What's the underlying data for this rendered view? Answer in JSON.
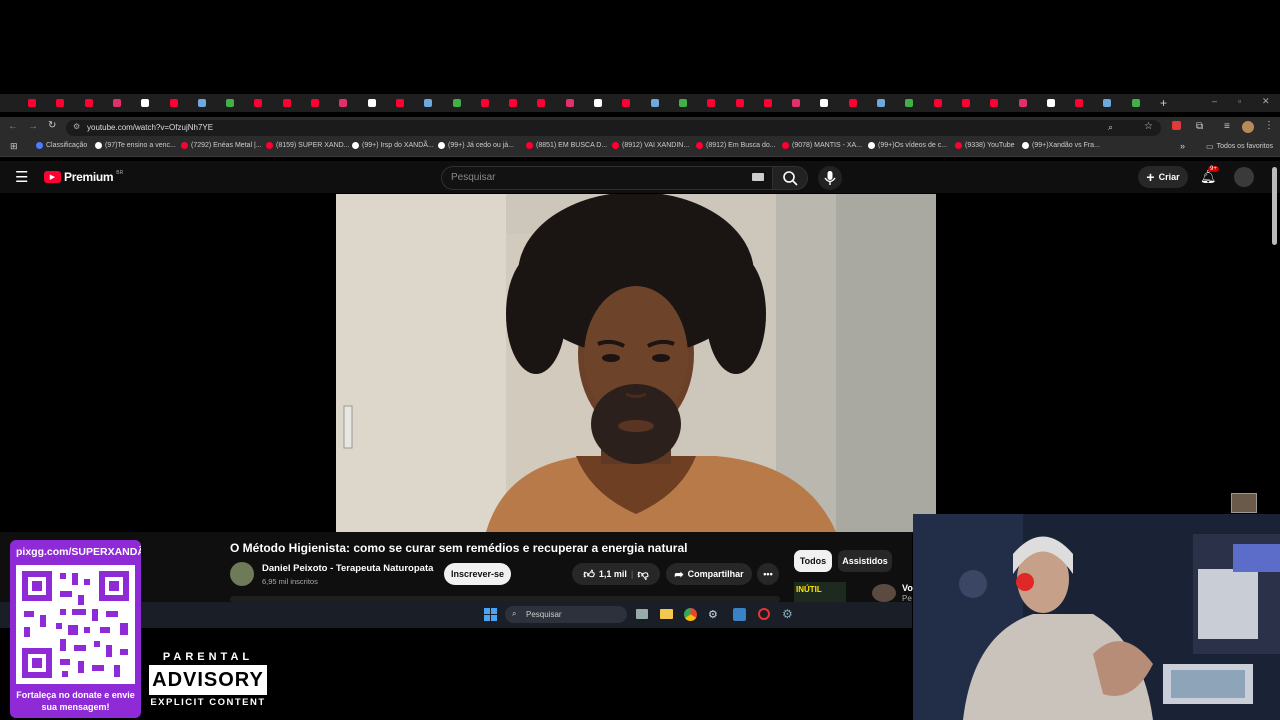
{
  "browser": {
    "tabs_count": 40,
    "url": "youtube.com/watch?v=OfzujNh7YE",
    "bookmarks": [
      {
        "label": "Classificação",
        "color": "#4d7cff"
      },
      {
        "label": "(97)Te ensino a venc...",
        "color": "#ffffff"
      },
      {
        "label": "(7292) Enéas Metal |...",
        "color": "#ff0033"
      },
      {
        "label": "(8159) SUPER XAND...",
        "color": "#ff0033"
      },
      {
        "label": "(99+) Irsp do XANDÃ...",
        "color": "#ffffff"
      },
      {
        "label": "(99+) Já cedo ou já...",
        "color": "#ffffff"
      },
      {
        "label": "(8851) EM BUSCA D...",
        "color": "#ff0033"
      },
      {
        "label": "(8912) VAI XANDIN...",
        "color": "#ff0033"
      },
      {
        "label": "(8912) Em Busca do...",
        "color": "#ff0033"
      },
      {
        "label": "(9078) MANTIS - XA...",
        "color": "#ff0033"
      },
      {
        "label": "(99+)Os vídeos de c...",
        "color": "#ffffff"
      },
      {
        "label": "(9338) YouTube",
        "color": "#ff0033"
      },
      {
        "label": "(99+)Xandão vs Fra...",
        "color": "#ffffff"
      }
    ],
    "all_bookmarks_label": "Todos os favoritos"
  },
  "youtube": {
    "logo_text": "Premium",
    "logo_badge": "BR",
    "search_placeholder": "Pesquisar",
    "create_label": "Criar",
    "notifications_count": "9+",
    "video_title": "O Método Higienista: como se curar sem remédios e recuperar a energia natural",
    "channel_name": "Daniel Peixoto - Terapeuta Naturopata",
    "subscribers": "6,95 mil inscritos",
    "subscribe_label": "Inscrever-se",
    "like_count": "1,1 mil",
    "share_label": "Compartilhar",
    "chip_all": "Todos",
    "chip_watched": "Assistidos",
    "related_thumb_text": "INÚTIL",
    "related_title_partial": "Vo",
    "related_subtitle_partial": "Pe"
  },
  "taskbar": {
    "search_placeholder": "Pesquisar"
  },
  "overlay": {
    "qr_url": "pixgg.com/SUPERXANDÃ",
    "qr_caption": "Fortaleça no donate e envie sua mensagem!",
    "advisory_top": "PARENTAL",
    "advisory_main": "ADVISORY",
    "advisory_bottom": "EXPLICIT CONTENT"
  },
  "colors": {
    "yt_red": "#ff0033",
    "qr_purple": "#8e2bd6",
    "browser_bg": "#2b2b2b"
  }
}
